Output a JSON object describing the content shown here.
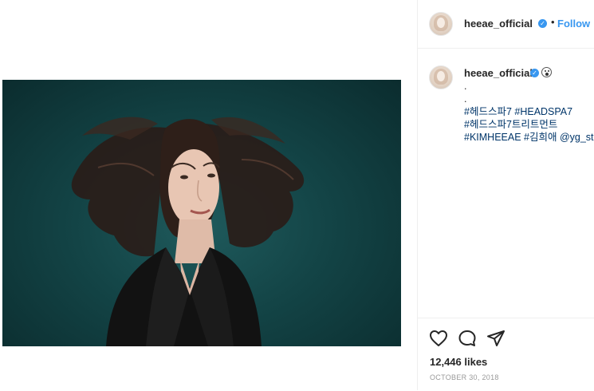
{
  "post": {
    "username": "heeae_official",
    "verified_mark": "✓",
    "separator": "•",
    "follow_label": "Follow",
    "photo_subject": "portrait-photo"
  },
  "comment": {
    "username": "heeae_official",
    "lines": [
      {
        "type": "plain",
        "text": "."
      },
      {
        "type": "plain",
        "text": "."
      },
      {
        "type": "tags",
        "text": "#헤드스파7 #HEADSPA7"
      },
      {
        "type": "tags",
        "text": "#헤드스파7트리트먼트"
      },
      {
        "type": "tags",
        "text": "#KIMHEEAE #김희애 @yg_stage"
      }
    ]
  },
  "actions": {
    "like_icon": "heart-icon",
    "comment_icon": "comment-bubble-icon",
    "share_icon": "paper-plane-icon",
    "likes_text": "12,446 likes",
    "date_text": "OCTOBER 30, 2018"
  },
  "colors": {
    "link_blue": "#3897f0",
    "hashtag": "#003569",
    "photo_background": "#134446",
    "muted": "#999999"
  }
}
